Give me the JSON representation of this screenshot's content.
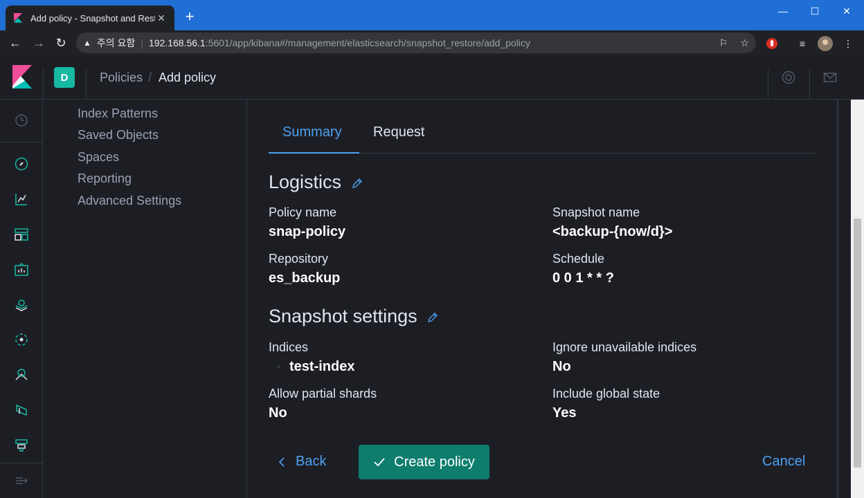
{
  "browser": {
    "tab_title": "Add policy - Snapshot and Rest",
    "insecure_label": "주의 요함",
    "url_host": "192.168.56.1",
    "url_rest": ":5601/app/kibana#/management/elasticsearch/snapshot_restore/add_policy"
  },
  "header": {
    "space_initial": "D",
    "breadcrumb_parent": "Policies",
    "breadcrumb_current": "Add policy"
  },
  "sidebar": {
    "items": [
      "Index Patterns",
      "Saved Objects",
      "Spaces",
      "Reporting",
      "Advanced Settings"
    ]
  },
  "tabs": {
    "summary": "Summary",
    "request": "Request"
  },
  "logistics": {
    "heading": "Logistics",
    "policy_name_label": "Policy name",
    "policy_name_value": "snap-policy",
    "snapshot_name_label": "Snapshot name",
    "snapshot_name_value": "<backup-{now/d}>",
    "repository_label": "Repository",
    "repository_value": "es_backup",
    "schedule_label": "Schedule",
    "schedule_value": "0 0 1 * * ?"
  },
  "snapshot_settings": {
    "heading": "Snapshot settings",
    "indices_label": "Indices",
    "indices_value": "test-index",
    "ignore_label": "Ignore unavailable indices",
    "ignore_value": "No",
    "partial_label": "Allow partial shards",
    "partial_value": "No",
    "global_label": "Include global state",
    "global_value": "Yes"
  },
  "actions": {
    "back": "Back",
    "create": "Create policy",
    "cancel": "Cancel"
  },
  "colors": {
    "accent": "#4da1f2",
    "primary_button": "#0f7d6e",
    "space_badge": "#16b8a2",
    "titlebar": "#1f6fd6"
  }
}
